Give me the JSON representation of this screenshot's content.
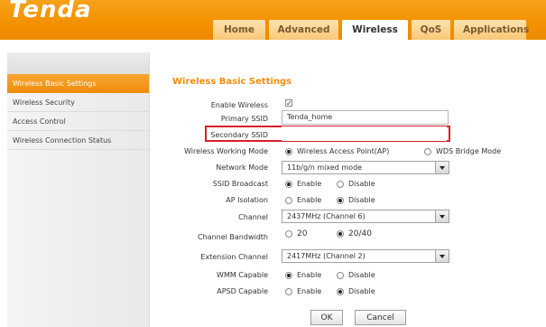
{
  "brand": {
    "logo": "Tenda"
  },
  "nav": {
    "tabs": [
      {
        "label": "Home"
      },
      {
        "label": "Advanced"
      },
      {
        "label": "Wireless"
      },
      {
        "label": "QoS"
      },
      {
        "label": "Applications"
      }
    ]
  },
  "sidebar": {
    "items": [
      {
        "label": "Wireless Basic Settings"
      },
      {
        "label": "Wireless Security"
      },
      {
        "label": "Access Control"
      },
      {
        "label": "Wireless Connection Status"
      }
    ]
  },
  "form": {
    "title": "Wireless Basic Settings",
    "enable_wireless": {
      "label": "Enable Wireless",
      "checked": true
    },
    "primary_ssid": {
      "label": "Primary SSID",
      "value": "Tenda_home"
    },
    "secondary_ssid": {
      "label": "Secondary SSID",
      "value": ""
    },
    "working_mode": {
      "label": "Wireless Working Mode",
      "options": [
        "Wireless Access Point(AP)",
        "WDS Bridge Mode"
      ],
      "selected": "Wireless Access Point(AP)"
    },
    "network_mode": {
      "label": "Network Mode",
      "value": "11b/g/n mixed mode"
    },
    "ssid_broadcast": {
      "label": "SSID Broadcast",
      "options": [
        "Enable",
        "Disable"
      ],
      "selected": "Enable"
    },
    "ap_isolation": {
      "label": "AP Isolation",
      "options": [
        "Enable",
        "Disable"
      ],
      "selected": "Disable"
    },
    "channel": {
      "label": "Channel",
      "value": "2437MHz (Channel 6)"
    },
    "channel_bandwidth": {
      "label": "Channel Bandwidth",
      "options": [
        "20",
        "20/40"
      ],
      "selected": "20/40"
    },
    "extension_channel": {
      "label": "Extension Channel",
      "value": "2417MHz (Channel 2)"
    },
    "wmm_capable": {
      "label": "WMM Capable",
      "options": [
        "Enable",
        "Disable"
      ],
      "selected": "Enable"
    },
    "apsd_capable": {
      "label": "APSD Capable",
      "options": [
        "Enable",
        "Disable"
      ],
      "selected": "Disable"
    },
    "ok_label": "OK",
    "cancel_label": "Cancel"
  },
  "colors": {
    "accent": "#f08d0a",
    "highlight_border": "#d6202a"
  }
}
